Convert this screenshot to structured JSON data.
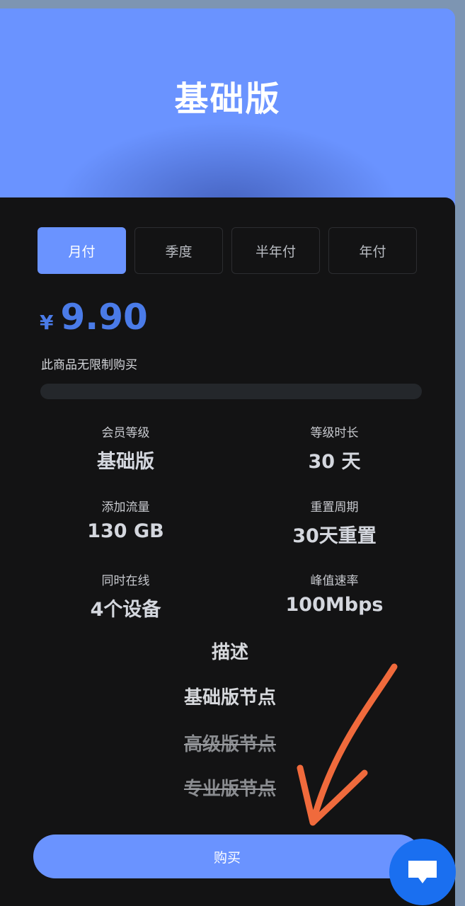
{
  "header": {
    "title": "基础版"
  },
  "tabs": [
    {
      "label": "月付",
      "active": true
    },
    {
      "label": "季度",
      "active": false
    },
    {
      "label": "半年付",
      "active": false
    },
    {
      "label": "年付",
      "active": false
    }
  ],
  "price": {
    "currency": "¥",
    "amount": "9.90"
  },
  "limit_note": "此商品无限制购买",
  "progress": {
    "fraction": 0
  },
  "stats": [
    {
      "label": "会员等级",
      "value": "基础版"
    },
    {
      "label": "等级时长",
      "value": "30 天"
    },
    {
      "label": "添加流量",
      "value": "130 GB"
    },
    {
      "label": "重置周期",
      "value": "30天重置"
    },
    {
      "label": "同时在线",
      "value": "4个设备"
    },
    {
      "label": "峰值速率",
      "value": "100Mbps"
    }
  ],
  "description": {
    "title": "描述",
    "items": [
      {
        "text": "基础版节点",
        "available": true
      },
      {
        "text": "高级版节点",
        "available": false
      },
      {
        "text": "专业版节点",
        "available": false
      }
    ]
  },
  "buy_button": {
    "label": "购买"
  },
  "colors": {
    "accent": "#6a93ff",
    "price": "#4a7be8",
    "card_bg": "#131314",
    "fab": "#1a6ff0",
    "annotation": "#f06a3c"
  },
  "icons": {
    "chat_fab": "chat-bubble-icon",
    "annotation": "orange-arrow-drawing"
  }
}
